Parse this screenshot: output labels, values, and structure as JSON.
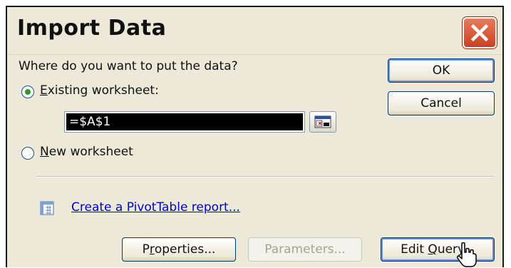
{
  "dialog": {
    "title": "Import Data",
    "prompt": "Where do you want to put the data?",
    "existing_worksheet": {
      "label_prefix": "",
      "accel": "E",
      "label_rest": "xisting worksheet:",
      "checked": true
    },
    "reference_value": "=$A$1",
    "new_worksheet": {
      "accel": "N",
      "label_rest": "ew worksheet",
      "checked": false
    },
    "pivot_link": "Create a PivotTable report...",
    "buttons": {
      "ok": "OK",
      "cancel": "Cancel",
      "properties_pre": "P",
      "properties_accel": "r",
      "properties_post": "operties...",
      "parameters": "Parameters...",
      "edit_query_pre": "Edit ",
      "edit_query_accel": "Q",
      "edit_query_post": "uery..."
    }
  },
  "icons": {
    "close": "close-x-icon",
    "collapse_dialog": "collapse-dialog-icon",
    "pivot": "pivottable-icon",
    "cursor": "mouse-pointer-icon"
  },
  "colors": {
    "dialog_bg": "#ece9d8",
    "close_red": "#c94322",
    "link_blue": "#0000cc",
    "radio_green": "#2a9b2a"
  }
}
